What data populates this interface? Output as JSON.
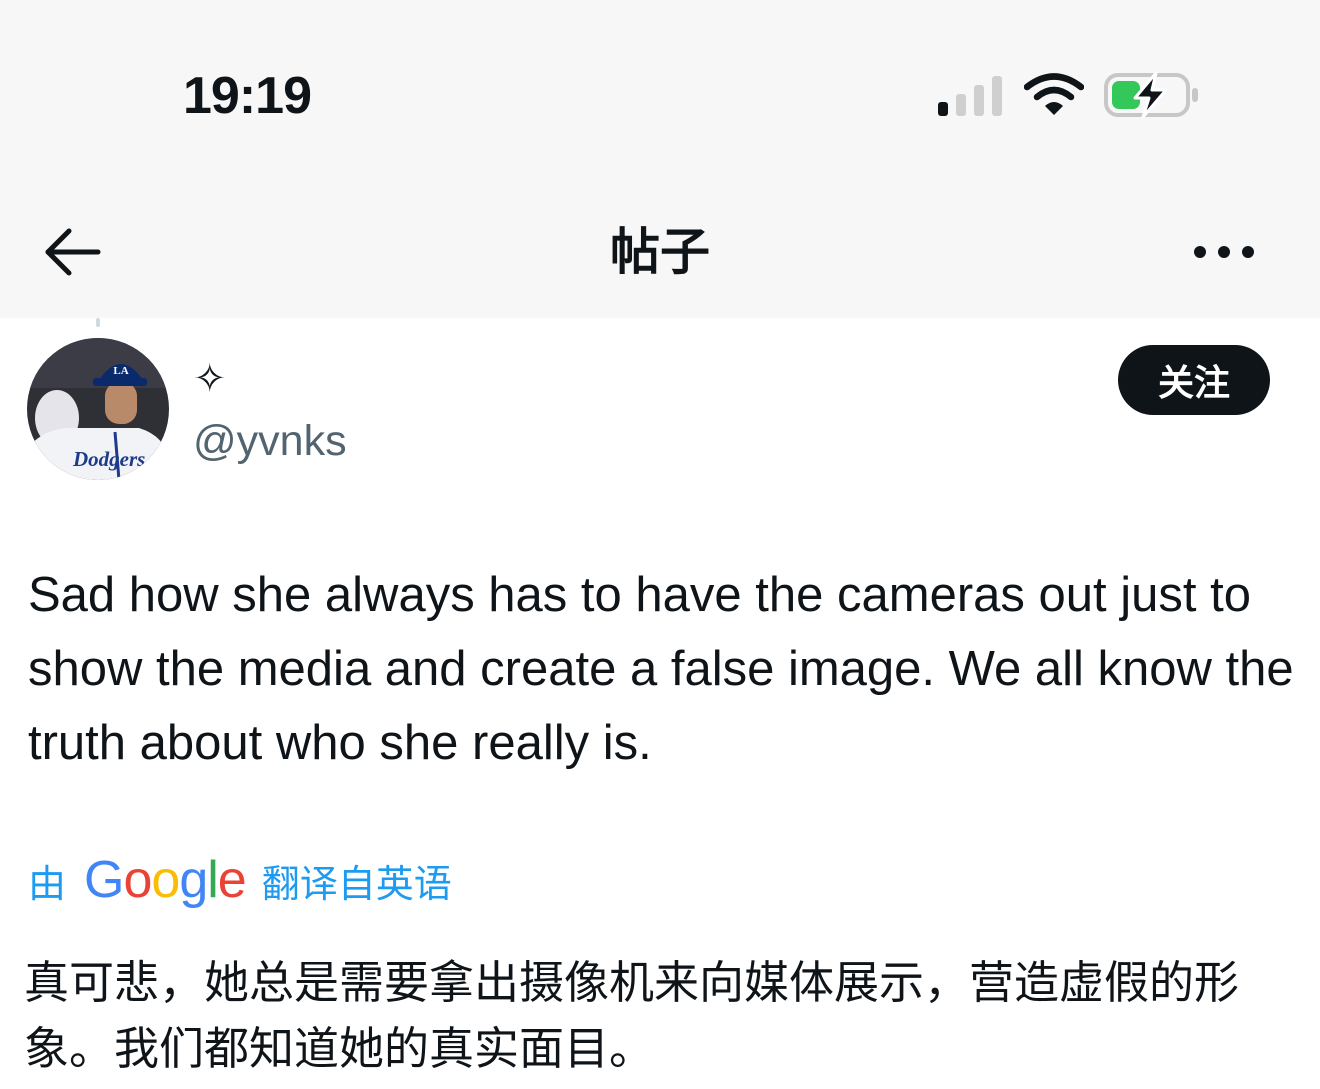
{
  "status_bar": {
    "time": "19:19",
    "icons": [
      "cellular-signal-icon",
      "wifi-icon",
      "battery-charging-icon"
    ]
  },
  "nav": {
    "title": "帖子",
    "back_icon": "arrow-left-icon",
    "more_icon": "more-horizontal-icon"
  },
  "post": {
    "author": {
      "display_name": "✧",
      "handle": "@yvnks",
      "avatar_text": "Dodgers"
    },
    "follow_label": "关注",
    "text": "Sad how she always has to have the cameras out just to show the media and create a false image. We all know the truth about who she really is.",
    "translation": {
      "by_label": "由",
      "provider_letters": [
        "G",
        "o",
        "o",
        "g",
        "l",
        "e"
      ],
      "provider_colors": [
        "#4285F4",
        "#EA4335",
        "#FBBC05",
        "#4285F4",
        "#34A853",
        "#EA4335"
      ],
      "from_label": "翻译自英语",
      "text": "真可悲，她总是需要拿出摄像机来向媒体展示，营造虚假的形象。我们都知道她的真实面目。"
    }
  },
  "colors": {
    "text_primary": "#0f1419",
    "text_secondary": "#536471",
    "link": "#1d9bf0",
    "button_bg": "#0f1419",
    "battery_green": "#34c759"
  }
}
